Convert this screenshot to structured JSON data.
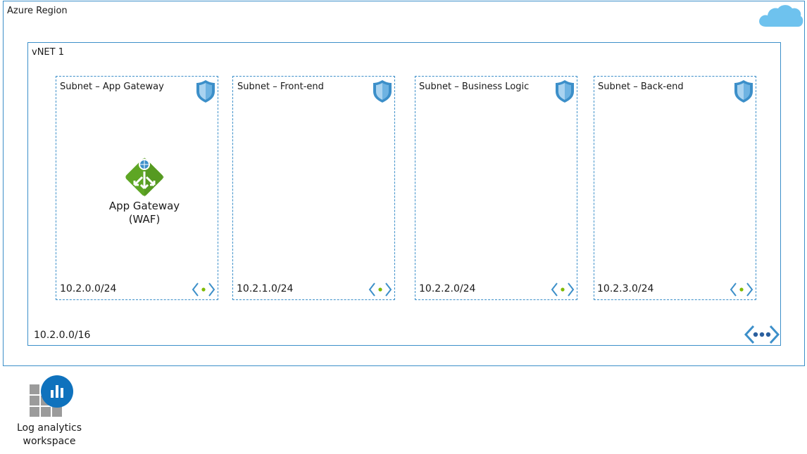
{
  "region": {
    "label": "Azure Region"
  },
  "vnet": {
    "label": "vNET 1",
    "cidr": "10.2.0.0/16"
  },
  "subnets": [
    {
      "title": "Subnet – App Gateway",
      "cidr": "10.2.0.0/24"
    },
    {
      "title": "Subnet – Front-end",
      "cidr": "10.2.1.0/24"
    },
    {
      "title": "Subnet – Business Logic",
      "cidr": "10.2.2.0/24"
    },
    {
      "title": "Subnet – Back-end",
      "cidr": "10.2.3.0/24"
    }
  ],
  "app_gateway": {
    "line1": "App Gateway",
    "line2": "(WAF)"
  },
  "log_analytics": {
    "line1": "Log analytics",
    "line2": "workspace"
  },
  "colors": {
    "border": "#3c8fc9",
    "shield": "#3c8fc9",
    "gateway_green": "#5ea624",
    "workspace_blue": "#0f72bd",
    "workspace_gray": "#9b9b9b",
    "cloud": "#6ec2ee",
    "peer_dot": "#7fba00"
  }
}
